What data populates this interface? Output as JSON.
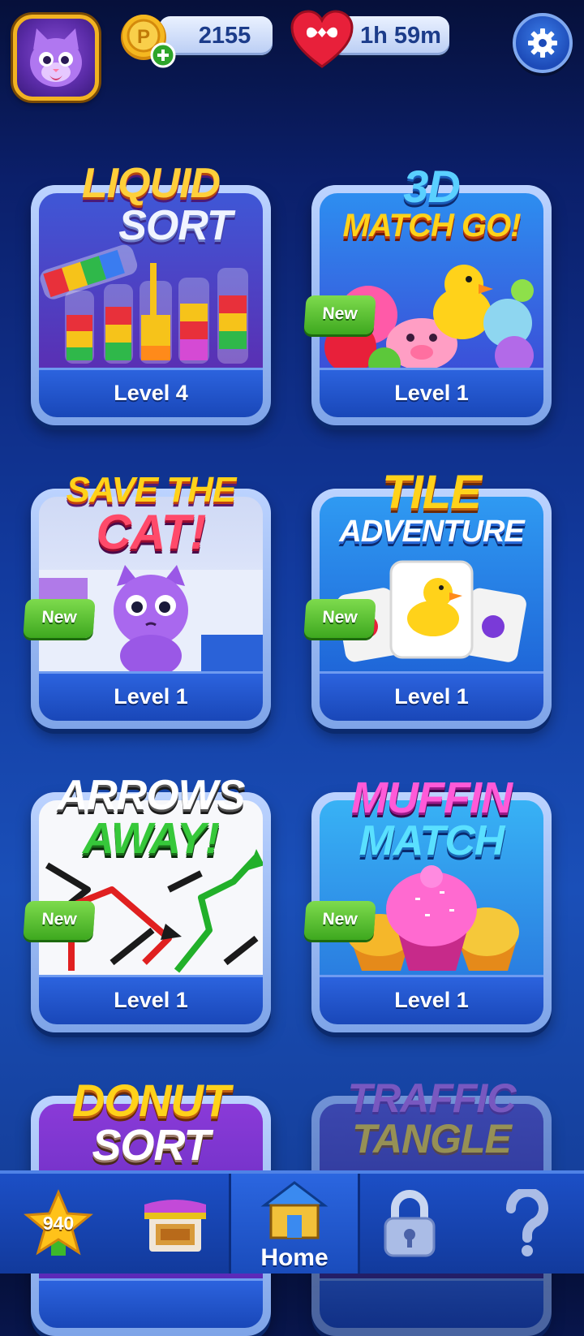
{
  "header": {
    "coins": "2155",
    "lives_timer": "1h 59m",
    "colors": {
      "coin": "#f5b820",
      "heart": "#e8203a",
      "pill_text": "#1c3c8a"
    }
  },
  "games": [
    {
      "title_line1": "LIQUID",
      "title_line2": "SORT",
      "level": "Level 4",
      "is_new": false,
      "new_label": ""
    },
    {
      "title_line1": "3D",
      "title_line2": "MATCH GO!",
      "level": "Level 1",
      "is_new": true,
      "new_label": "New"
    },
    {
      "title_line1": "SAVE THE",
      "title_line2": "CAT!",
      "level": "Level 1",
      "is_new": true,
      "new_label": "New"
    },
    {
      "title_line1": "TILE",
      "title_line2": "ADVENTURE",
      "level": "Level 1",
      "is_new": true,
      "new_label": "New"
    },
    {
      "title_line1": "ARROWS",
      "title_line2": "AWAY!",
      "level": "Level 1",
      "is_new": true,
      "new_label": "New"
    },
    {
      "title_line1": "MUFFIN",
      "title_line2": "MATCH",
      "level": "Level 1",
      "is_new": true,
      "new_label": "New"
    },
    {
      "title_line1": "DONUT",
      "title_line2": "SORT",
      "level": "",
      "is_new": false,
      "new_label": ""
    },
    {
      "title_line1": "TRAFFIC",
      "title_line2": "TANGLE",
      "level": "",
      "is_new": false,
      "new_label": ""
    }
  ],
  "bottom_nav": {
    "stars": "940",
    "home_label": "Home",
    "items": [
      "star-icon",
      "shop-icon",
      "home-icon",
      "lock-icon",
      "question-icon"
    ]
  }
}
